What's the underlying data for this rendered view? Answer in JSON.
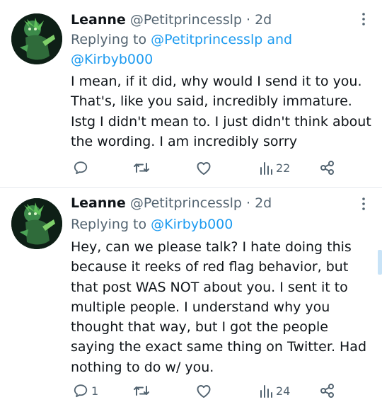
{
  "tweets": [
    {
      "display_name": "Leanne",
      "handle": "@Petitprincesslp",
      "separator": "·",
      "time": "2d",
      "replying_prefix": "Replying to",
      "replying_to_1": "@Petitprincesslp",
      "replying_join": "and",
      "replying_to_2": "@Kirbyb000",
      "text": "I mean, if it did, why would I send it to you. That's, like you said, incredibly immature. Istg I didn't mean to. I just didn't think about the wording. I am incredibly sorry",
      "reply_count": "",
      "views": "22"
    },
    {
      "display_name": "Leanne",
      "handle": "@Petitprincesslp",
      "separator": "·",
      "time": "2d",
      "replying_prefix": "Replying to",
      "replying_to_1": "@Kirbyb000",
      "text": "Hey, can we please talk? I hate doing this because it reeks of red flag behavior, but that post WAS NOT about you. I sent it to multiple people. I understand why you thought that way, but I got the people saying the exact same thing on Twitter. Had nothing to do w/ you.",
      "reply_count": "1",
      "views": "24"
    }
  ],
  "colors": {
    "accent": "#1d9bf0",
    "secondary_text": "#536471",
    "text": "#0f1419"
  },
  "icons": [
    "avatar",
    "more-icon",
    "reply-icon",
    "retweet-icon",
    "like-icon",
    "views-icon",
    "share-icon"
  ]
}
